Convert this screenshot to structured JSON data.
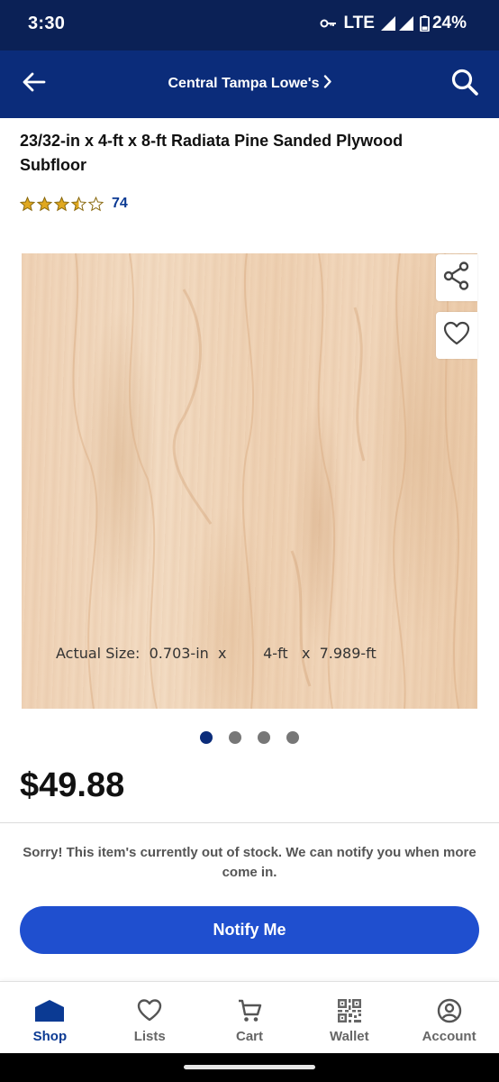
{
  "status_bar": {
    "time": "3:30",
    "network": "LTE",
    "battery": "24%",
    "icons": [
      "key-icon",
      "signal-icon",
      "signal-icon",
      "battery-icon"
    ]
  },
  "header": {
    "back_icon": "arrow-left-icon",
    "store_label": "Central Tampa Lowe's",
    "store_icon": "chevron-right-icon",
    "search_icon": "search-icon",
    "background": "#0b2c7a"
  },
  "product": {
    "title": "23/32-in x 4-ft x 8-ft Radiata Pine Sanded Plywood Subfloor",
    "rating": 3.5,
    "rating_max": 5,
    "review_count": "74",
    "image_caption": "Actual Size:  0.703-in  x        4-ft   x  7.989-ft",
    "share_icon": "share-icon",
    "favorite_icon": "heart-icon",
    "image_count": 4,
    "active_image": 1,
    "price": "$49.88",
    "stock_message": "Sorry! This item's currently out of stock. We can notify you when more come in.",
    "notify_label": "Notify Me"
  },
  "colors": {
    "brand_dark": "#0b2156",
    "brand": "#0b2c7a",
    "button": "#1f4fcf",
    "star": "#e0a820",
    "link": "#0b3a93"
  },
  "bottom_nav": {
    "items": [
      {
        "label": "Shop",
        "icon": "store-icon",
        "active": true
      },
      {
        "label": "Lists",
        "icon": "heart-icon",
        "active": false
      },
      {
        "label": "Cart",
        "icon": "cart-icon",
        "active": false
      },
      {
        "label": "Wallet",
        "icon": "qr-code-icon",
        "active": false
      },
      {
        "label": "Account",
        "icon": "account-icon",
        "active": false
      }
    ]
  }
}
